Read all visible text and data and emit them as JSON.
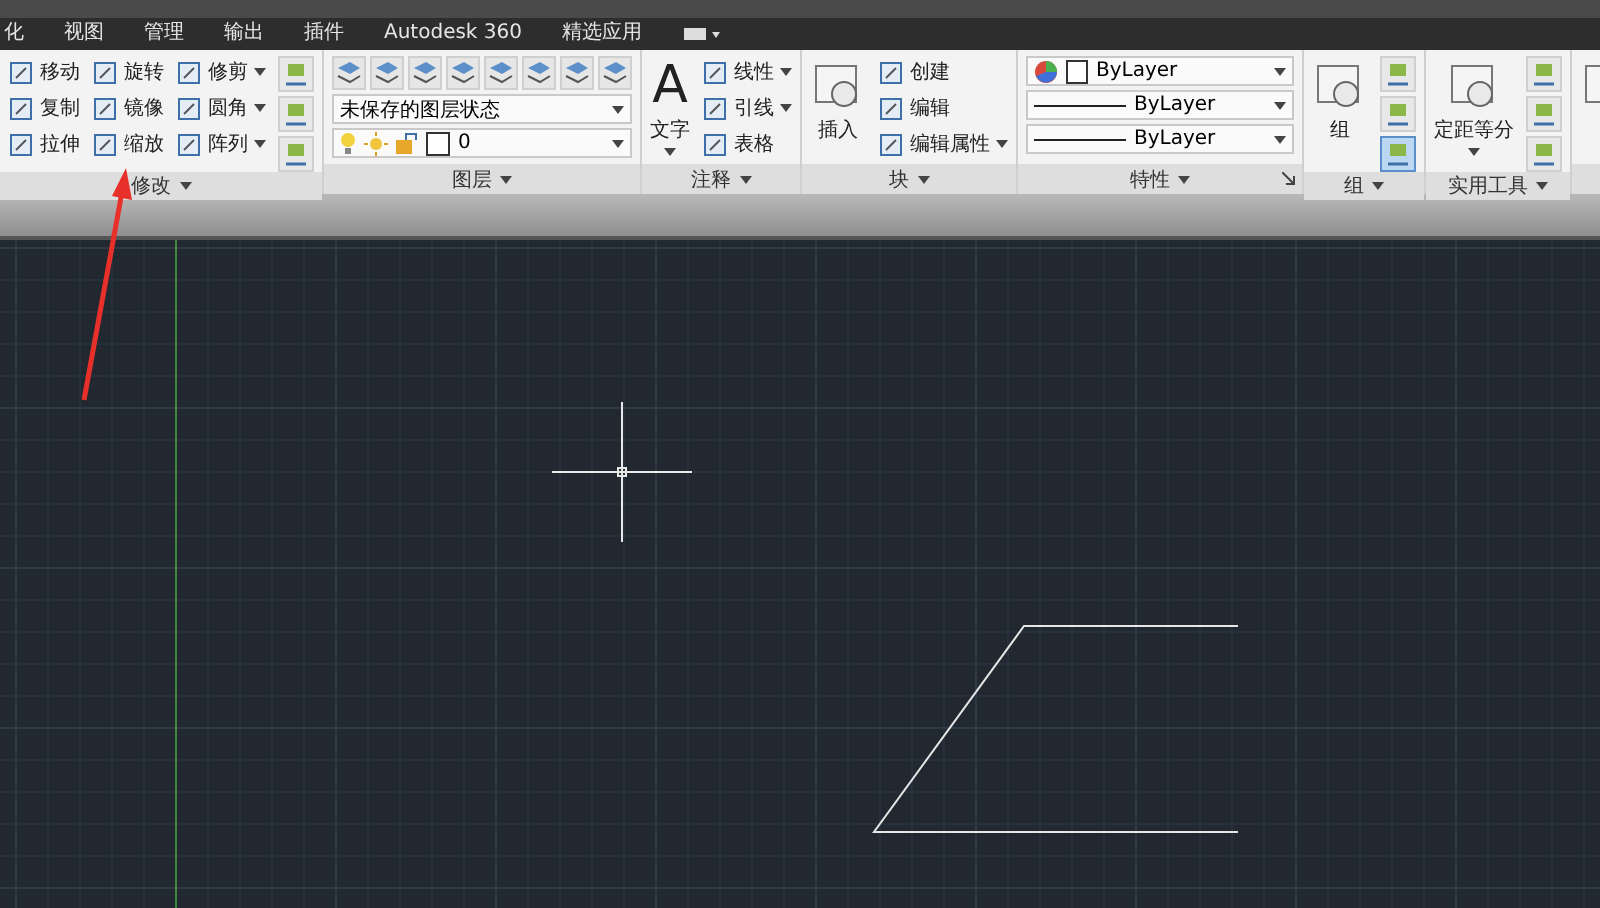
{
  "tabs": [
    {
      "label": "化"
    },
    {
      "label": "视图"
    },
    {
      "label": "管理"
    },
    {
      "label": "输出"
    },
    {
      "label": "插件"
    },
    {
      "label": "Autodesk 360"
    },
    {
      "label": "精选应用"
    }
  ],
  "panels": [
    {
      "title": "修改",
      "show_launcher": false,
      "columns": [
        [
          {
            "kind": "tool",
            "label": "移动",
            "has_menu": false
          },
          {
            "kind": "tool",
            "label": "复制",
            "has_menu": false
          },
          {
            "kind": "tool",
            "label": "拉伸",
            "has_menu": false
          }
        ],
        [
          {
            "kind": "tool",
            "label": "旋转",
            "has_menu": false
          },
          {
            "kind": "tool",
            "label": "镜像",
            "has_menu": false
          },
          {
            "kind": "tool",
            "label": "缩放",
            "has_menu": false
          }
        ],
        [
          {
            "kind": "tool",
            "label": "修剪",
            "has_menu": true
          },
          {
            "kind": "tool",
            "label": "圆角",
            "has_menu": true
          },
          {
            "kind": "tool",
            "label": "阵列",
            "has_menu": true
          }
        ],
        [
          {
            "kind": "icon",
            "on": false
          },
          {
            "kind": "icon",
            "on": false
          },
          {
            "kind": "icon",
            "on": false
          }
        ]
      ]
    },
    {
      "title": "图层",
      "show_launcher": false,
      "columns": [
        [
          {
            "kind": "icon-strip"
          },
          {
            "kind": "select",
            "value": "未保存的图层状态",
            "swatch": false,
            "line": false,
            "wide": true
          },
          {
            "kind": "layer-select",
            "value": "0"
          }
        ]
      ]
    },
    {
      "title": "注释",
      "show_launcher": false,
      "columns": [
        [
          {
            "kind": "large",
            "label": "文字",
            "has_menu": true,
            "glyph": "A"
          }
        ],
        [
          {
            "kind": "tool",
            "label": "线性",
            "has_menu": true
          },
          {
            "kind": "tool",
            "label": "引线",
            "has_menu": true
          },
          {
            "kind": "tool",
            "label": "表格",
            "has_menu": false
          }
        ]
      ]
    },
    {
      "title": "块",
      "show_launcher": false,
      "columns": [
        [
          {
            "kind": "large",
            "label": "插入",
            "has_menu": false
          }
        ],
        [
          {
            "kind": "tool",
            "label": "创建",
            "has_menu": false
          },
          {
            "kind": "tool",
            "label": "编辑",
            "has_menu": false
          },
          {
            "kind": "tool",
            "label": "编辑属性",
            "has_menu": true
          }
        ]
      ]
    },
    {
      "title": "特性",
      "show_launcher": true,
      "columns": [
        [
          {
            "kind": "select",
            "value": "ByLayer",
            "swatch": true,
            "line": false,
            "wide": false
          },
          {
            "kind": "select",
            "value": "ByLayer",
            "swatch": false,
            "line": true,
            "wide": false
          },
          {
            "kind": "select",
            "value": "ByLayer",
            "swatch": false,
            "line": true,
            "wide": false
          }
        ]
      ]
    },
    {
      "title": "组",
      "show_launcher": false,
      "columns": [
        [
          {
            "kind": "large",
            "label": "组",
            "has_menu": false
          }
        ],
        [
          {
            "kind": "icon",
            "on": false
          },
          {
            "kind": "icon",
            "on": false
          },
          {
            "kind": "icon",
            "on": true
          }
        ]
      ]
    },
    {
      "title": "实用工具",
      "show_launcher": false,
      "columns": [
        [
          {
            "kind": "large",
            "label": "定距等分",
            "has_menu": true
          }
        ],
        [
          {
            "kind": "icon",
            "on": false
          },
          {
            "kind": "icon",
            "on": false
          },
          {
            "kind": "icon",
            "on": false
          }
        ]
      ]
    },
    {
      "columns": [
        [
          {
            "kind": "large",
            "has_menu": false
          }
        ]
      ]
    }
  ]
}
